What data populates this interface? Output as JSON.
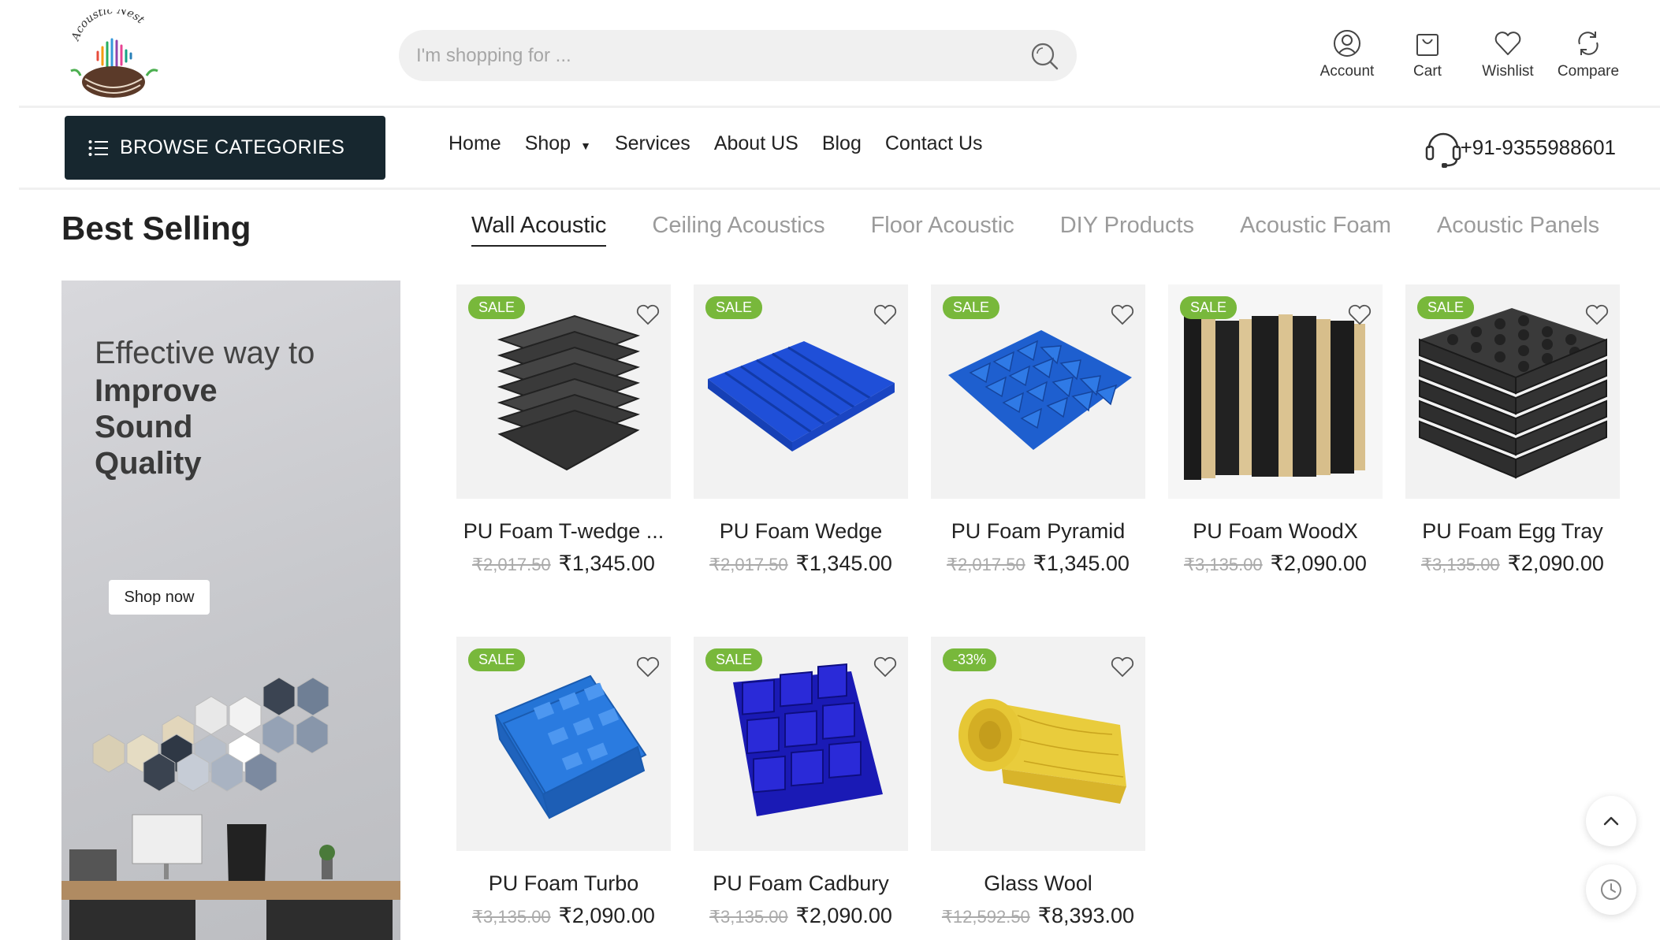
{
  "search": {
    "placeholder": "I'm shopping for ..."
  },
  "header_links": [
    {
      "label": "Account",
      "icon": "account-icon"
    },
    {
      "label": "Cart",
      "icon": "cart-icon"
    },
    {
      "label": "Wishlist",
      "icon": "wishlist-icon"
    },
    {
      "label": "Compare",
      "icon": "compare-icon"
    }
  ],
  "nav": {
    "browse_label": "BROWSE CATEGORIES",
    "links": [
      "Home",
      "Shop",
      "Services",
      "About US",
      "Blog",
      "Contact Us"
    ],
    "phone": "+91-9355988601"
  },
  "section": {
    "title": "Best Selling",
    "tabs": [
      "Wall Acoustic",
      "Ceiling Acoustics",
      "Floor Acoustic",
      "DIY Products",
      "Acoustic Foam",
      "Acoustic Panels"
    ],
    "active_tab": "Wall Acoustic"
  },
  "banner": {
    "line1": "Effective way to",
    "line2": "Improve",
    "line3": "Sound",
    "line4": "Quality",
    "button": "Shop now"
  },
  "colors": {
    "accent": "#17272f",
    "badge": "#78b83b"
  },
  "products": [
    {
      "name": "PU Foam T-wedge ...",
      "old_price": "₹2,017.50",
      "price": "₹1,345.00",
      "badge": "SALE"
    },
    {
      "name": "PU Foam Wedge",
      "old_price": "₹2,017.50",
      "price": "₹1,345.00",
      "badge": "SALE"
    },
    {
      "name": "PU Foam Pyramid",
      "old_price": "₹2,017.50",
      "price": "₹1,345.00",
      "badge": "SALE"
    },
    {
      "name": "PU Foam WoodX",
      "old_price": "₹3,135.00",
      "price": "₹2,090.00",
      "badge": "SALE"
    },
    {
      "name": "PU Foam Egg Tray",
      "old_price": "₹3,135.00",
      "price": "₹2,090.00",
      "badge": "SALE"
    },
    {
      "name": "PU Foam Turbo",
      "old_price": "₹3,135.00",
      "price": "₹2,090.00",
      "badge": "SALE"
    },
    {
      "name": "PU Foam Cadbury",
      "old_price": "₹3,135.00",
      "price": "₹2,090.00",
      "badge": "SALE"
    },
    {
      "name": "Glass Wool",
      "old_price": "₹12,592.50",
      "price": "₹8,393.00",
      "badge": "-33%"
    }
  ]
}
